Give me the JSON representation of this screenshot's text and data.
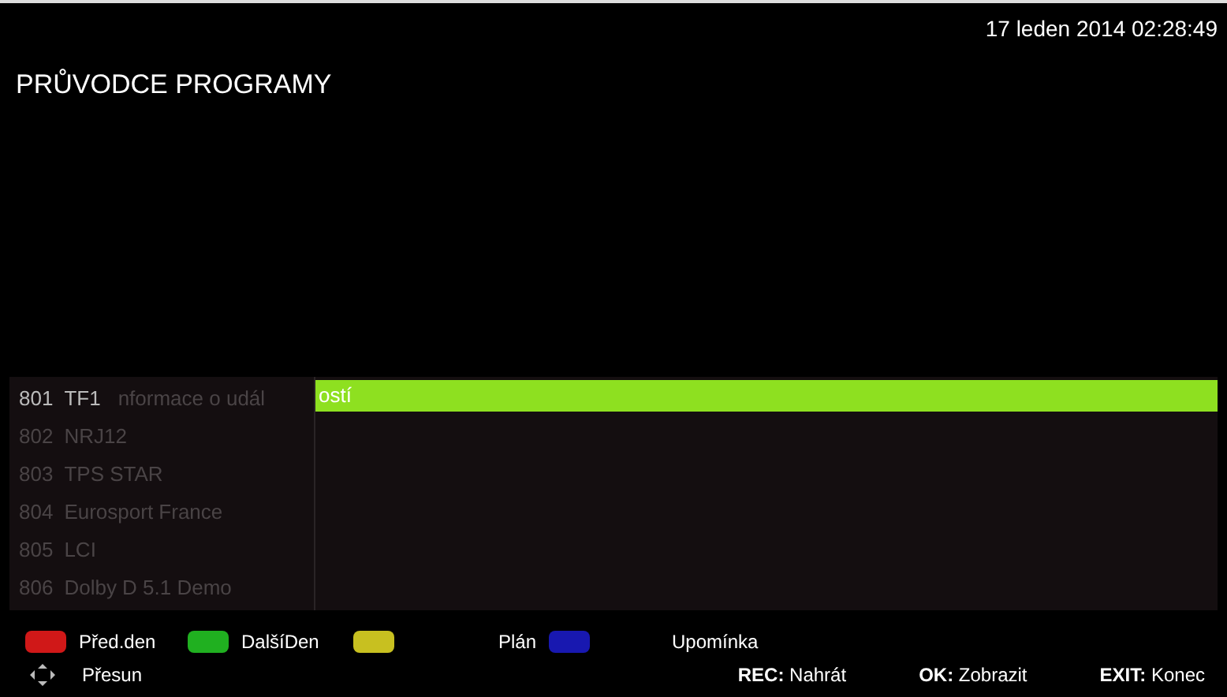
{
  "datetime": "17 leden 2014 02:28:49",
  "title": "PRŮVODCE PROGRAMY",
  "channels": [
    {
      "number": "801",
      "name": "TF1",
      "selected": true
    },
    {
      "number": "802",
      "name": "NRJ12",
      "selected": false
    },
    {
      "number": "803",
      "name": "TPS STAR",
      "selected": false
    },
    {
      "number": "804",
      "name": "Eurosport France",
      "selected": false
    },
    {
      "number": "805",
      "name": "LCI",
      "selected": false
    },
    {
      "number": "806",
      "name": "Dolby D 5.1 Demo",
      "selected": false
    }
  ],
  "event_info": {
    "faded_text": "nformace o udál",
    "bar_text": "ostí"
  },
  "legend": [
    {
      "kind": "key_label",
      "color": "#d01818",
      "label": "Před.den"
    },
    {
      "kind": "key_label",
      "color": "#20b020",
      "label": "DalšíDen"
    },
    {
      "kind": "key",
      "color": "#c8c020"
    },
    {
      "kind": "label_key",
      "color": "#1818b0",
      "label": "Plán"
    },
    {
      "kind": "label",
      "label": "Upomínka"
    }
  ],
  "footer": {
    "move_label": "Přesun",
    "keys": [
      {
        "key": "REC:",
        "action": "Nahrát"
      },
      {
        "key": "OK:",
        "action": "Zobrazit"
      },
      {
        "key": "EXIT:",
        "action": "Konec"
      }
    ]
  }
}
